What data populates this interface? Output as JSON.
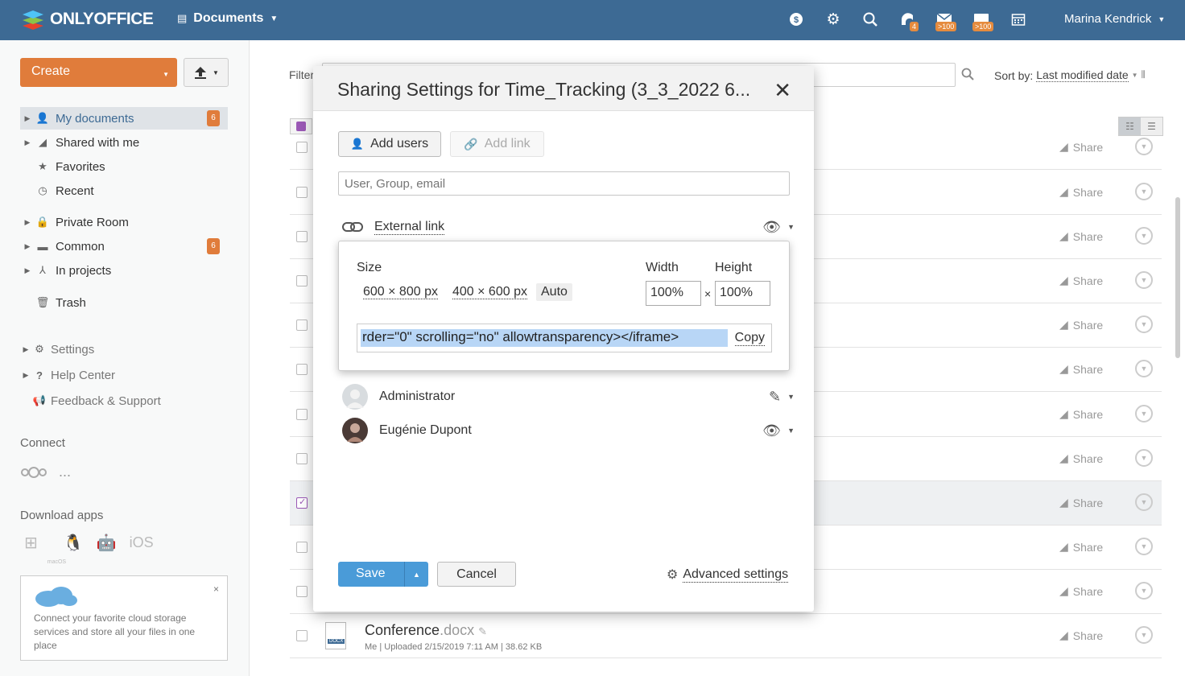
{
  "header": {
    "logo_text": "ONLYOFFICE",
    "module": "Documents",
    "user": "Marina Kendrick",
    "icons": [
      {
        "name": "dollar-icon",
        "glyph": "$",
        "badge": ""
      },
      {
        "name": "gear-icon",
        "glyph": "⚙",
        "badge": ""
      },
      {
        "name": "search-icon",
        "glyph": "⌕",
        "badge": ""
      },
      {
        "name": "feed-icon",
        "glyph": "◜",
        "badge": "4"
      },
      {
        "name": "mail-icon",
        "glyph": "✉",
        "badge": ">100"
      },
      {
        "name": "chat-icon",
        "glyph": "▭",
        "badge": ">100"
      },
      {
        "name": "calendar-icon",
        "glyph": "▦",
        "badge": ""
      }
    ]
  },
  "sidebar": {
    "create_label": "Create",
    "items": [
      {
        "label": "My documents",
        "count": "6"
      },
      {
        "label": "Shared with me"
      },
      {
        "label": "Favorites"
      },
      {
        "label": "Recent"
      },
      {
        "label": "Private Room"
      },
      {
        "label": "Common",
        "count": "6"
      },
      {
        "label": "In projects"
      },
      {
        "label": "Trash"
      }
    ],
    "settings": "Settings",
    "help": "Help Center",
    "feedback": "Feedback & Support",
    "connect_title": "Connect",
    "connect_more": "...",
    "download_title": "Download apps",
    "ios_label": "iOS",
    "macos_label": "macOS",
    "cloud_text": "Connect your favorite cloud storage services and store all your files in one place",
    "cloud_close": "×"
  },
  "main": {
    "filter_label": "Filter",
    "sort_label": "Sort by:",
    "sort_value": "Last modified date",
    "share_label": "Share",
    "last_file": {
      "name": "Conference",
      "ext": ".docx",
      "meta": "Me | Uploaded 2/15/2019 7:11 AM | 38.62 KB",
      "icon_label": "DOCX"
    }
  },
  "modal": {
    "title": "Sharing Settings for Time_Tracking (3_3_2022 6...",
    "close": "✕",
    "add_users": "Add users",
    "add_link": "Add link",
    "user_placeholder": "User, Group, email",
    "external_link": "External link",
    "embed": {
      "size_label": "Size",
      "width_label": "Width",
      "height_label": "Height",
      "size_option_1": "600 × 800 px",
      "size_option_2": "400 × 600 px",
      "size_option_3": "Auto",
      "width_value": "100%",
      "height_value": "100%",
      "times": "×",
      "code": "rder=\"0\" scrolling=\"no\" allowtransparency></iframe>",
      "copy": "Copy"
    },
    "users": [
      {
        "name": "Administrator",
        "right": "edit"
      },
      {
        "name": "Eugénie Dupont",
        "right": "view"
      }
    ],
    "save": "Save",
    "cancel": "Cancel",
    "advanced": "Advanced settings"
  }
}
